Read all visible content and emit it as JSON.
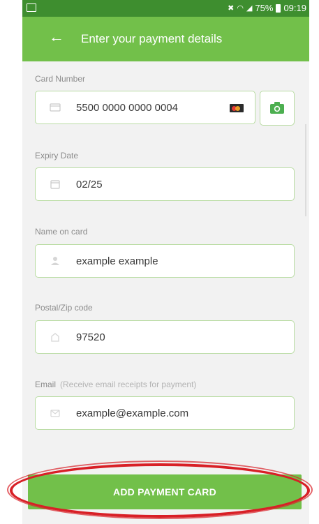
{
  "status_bar": {
    "signal_text": "75%",
    "time": "09:19"
  },
  "app_bar": {
    "title": "Enter your payment details",
    "back_icon": "arrow-left-icon"
  },
  "form": {
    "card_number": {
      "label": "Card Number",
      "value": "5500 0000 0000 0004",
      "icon": "card-icon",
      "brand_icon": "mastercard-icon"
    },
    "expiry": {
      "label": "Expiry Date",
      "value": "02/25",
      "icon": "calendar-icon"
    },
    "name": {
      "label": "Name on card",
      "value": "example example",
      "icon": "person-icon"
    },
    "postal": {
      "label": "Postal/Zip code",
      "value": "97520",
      "icon": "home-icon"
    },
    "email": {
      "label": "Email",
      "hint": "(Receive email receipts for payment)",
      "value": "example@example.com",
      "icon": "envelope-icon"
    }
  },
  "actions": {
    "camera_icon": "camera-icon",
    "add_label": "ADD PAYMENT CARD"
  },
  "colors": {
    "status_bar": "#3e8e2f",
    "accent": "#72c04a",
    "field_border": "#b9dca3",
    "highlight": "#d81f26"
  }
}
